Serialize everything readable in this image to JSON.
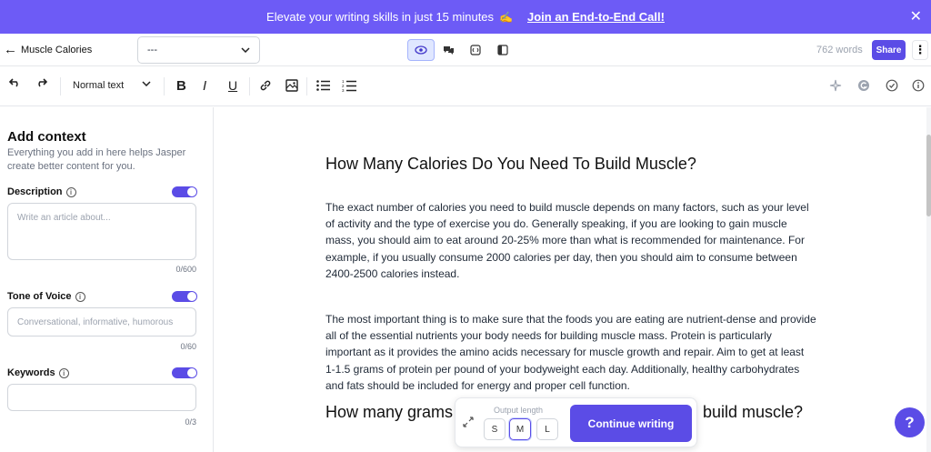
{
  "banner": {
    "promo_text": "Elevate your writing skills in just 15 minutes",
    "emoji": "✍️",
    "cta_label": "Join an End-to-End Call!",
    "close_icon": "close-icon"
  },
  "topbar": {
    "back_icon": "arrow-left-icon",
    "doc_title": "Muscle Calories",
    "doc_select_value": "---",
    "view_buttons": [
      "preview-icon",
      "chat-icon",
      "commands-icon",
      "sidebar-icon"
    ],
    "word_count": "762 words",
    "share_label": "Share",
    "more_icon": "more-vertical-icon"
  },
  "toolbar": {
    "undo_icon": "undo-icon",
    "redo_icon": "redo-icon",
    "text_style": "Normal text",
    "bold": "B",
    "italic": "I",
    "underline": "U",
    "right_icons": [
      "sparkle-icon",
      "grammar-icon",
      "check-circle-icon",
      "info-icon"
    ]
  },
  "sidebar": {
    "title": "Add context",
    "subtitle": "Everything you add in here helps Jasper create better content for you.",
    "description": {
      "label": "Description",
      "placeholder": "Write an article about...",
      "counter": "0/600",
      "enabled": true
    },
    "tone": {
      "label": "Tone of Voice",
      "placeholder": "Conversational, informative, humorous",
      "counter": "0/60",
      "enabled": true
    },
    "keywords": {
      "label": "Keywords",
      "placeholder": "",
      "counter": "0/3",
      "enabled": true
    }
  },
  "editor": {
    "heading": "How Many Calories Do You Need To Build Muscle?",
    "paragraph1": "The exact number of calories you need to build muscle depends on many factors, such as your level of activity and the type of exercise you do. Generally speaking, if you are looking to gain muscle mass, you should aim to eat around 20-25% more than what is recommended for maintenance. For example, if you usually consume 2000 calories per day, then you should aim to consume between 2400-2500 calories instead.",
    "paragraph2": "The most important thing is to make sure that the foods you are eating are nutrient-dense and provide all of the essential nutrients your body needs for building muscle mass. Protein is particularly important as it provides the amino acids necessary for muscle growth and repair. Aim to get at least 1-1.5 grams of protein per pound of your bodyweight each day. Additionally, healthy carbohydrates and fats should be included for energy and proper cell function.",
    "heading2_left": "How many grams",
    "heading2_right": "build muscle?"
  },
  "output_panel": {
    "label": "Output length",
    "sizes": [
      "S",
      "M",
      "L"
    ],
    "selected": "M",
    "continue_label": "Continue writing"
  },
  "help_label": "?"
}
